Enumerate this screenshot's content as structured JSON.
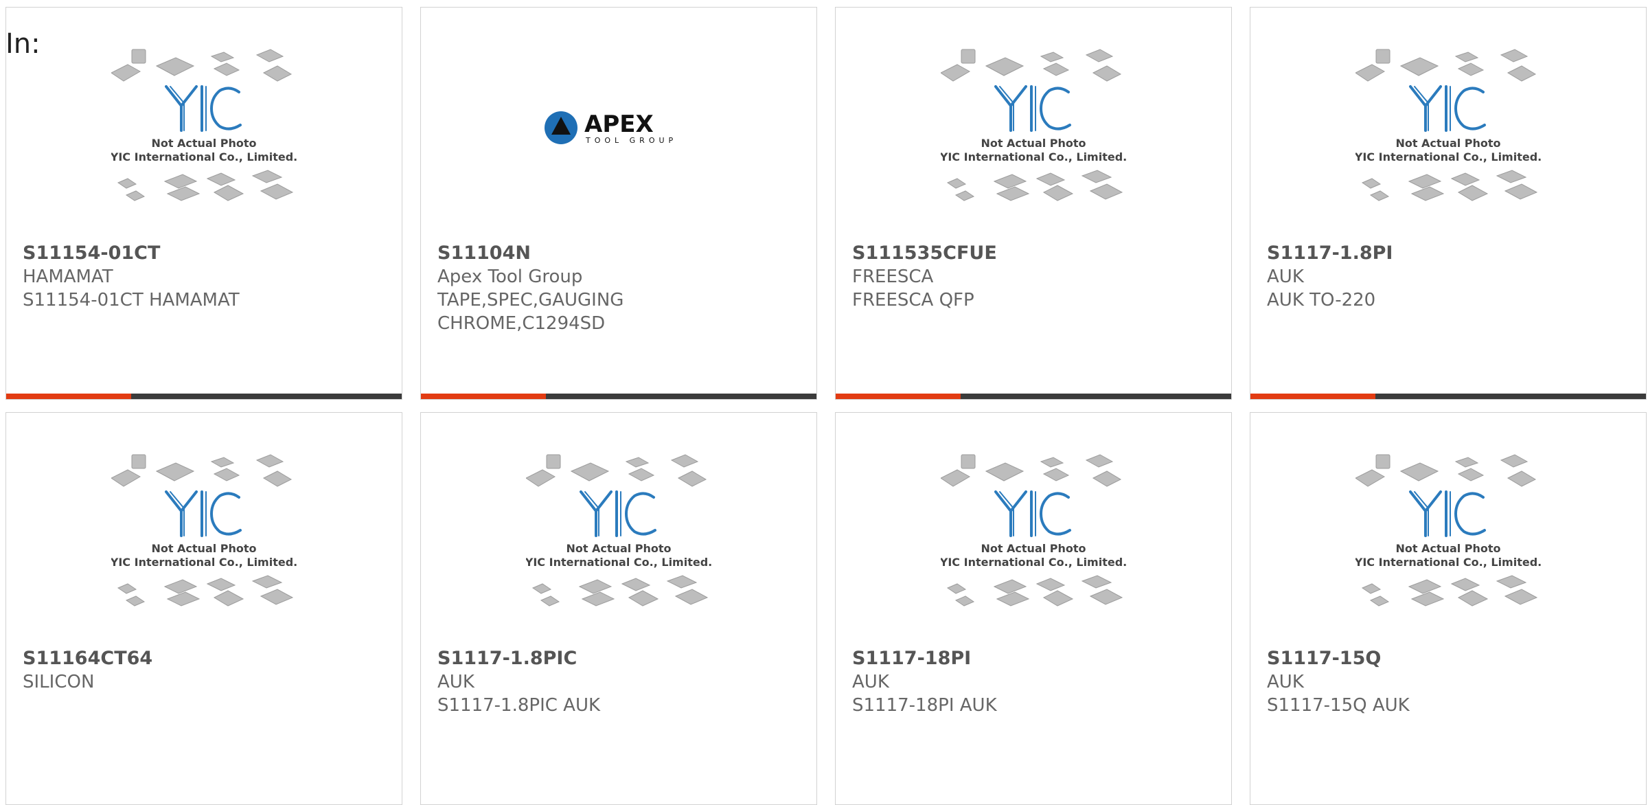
{
  "search": {
    "label": "In:"
  },
  "placeholder_image": {
    "caption_line1": "Not Actual Photo",
    "caption_line2": "YIC International Co., Limited.",
    "logo_text": "YIC"
  },
  "apex_logo": {
    "brand": "APEX",
    "tagline": "TOOL GROUP"
  },
  "colors": {
    "accent": "#e23b12",
    "bar": "#3b3b3b",
    "logo_blue": "#2b7bbd"
  },
  "products": [
    {
      "part": "S11154-01CT",
      "maker": "HAMAMAT",
      "desc": "S11154-01CT HAMAMAT",
      "image": "yic-placeholder",
      "show_bar": true
    },
    {
      "part": "S11104N",
      "maker": "Apex Tool Group",
      "desc": "TAPE,SPEC,GAUGING\nCHROME,C1294SD",
      "image": "apex-logo",
      "show_bar": true
    },
    {
      "part": "S111535CFUE",
      "maker": "FREESCA",
      "desc": "FREESCA QFP",
      "image": "yic-placeholder",
      "show_bar": true
    },
    {
      "part": "S1117-1.8PI",
      "maker": "AUK",
      "desc": "AUK TO-220",
      "image": "yic-placeholder",
      "show_bar": true
    },
    {
      "part": "S11164CT64",
      "maker": "SILICON",
      "desc": "",
      "image": "yic-placeholder",
      "show_bar": false
    },
    {
      "part": "S1117-1.8PIC",
      "maker": "AUK",
      "desc": "S1117-1.8PIC AUK",
      "image": "yic-placeholder",
      "show_bar": false
    },
    {
      "part": "S1117-18PI",
      "maker": "AUK",
      "desc": "S1117-18PI AUK",
      "image": "yic-placeholder",
      "show_bar": false
    },
    {
      "part": "S1117-15Q",
      "maker": "AUK",
      "desc": "S1117-15Q AUK",
      "image": "yic-placeholder",
      "show_bar": false
    }
  ]
}
